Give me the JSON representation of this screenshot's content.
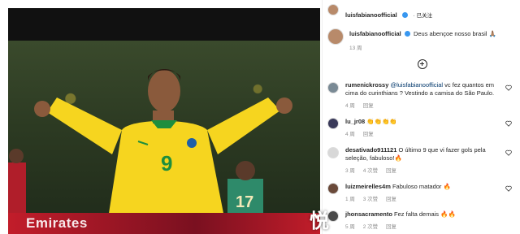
{
  "photo": {
    "banner_text": "Emirates"
  },
  "header": {
    "username": "luisfabianoofficial",
    "follow_label": "· 已关注"
  },
  "caption": {
    "username": "luisfabianoofficial",
    "text": "Deus abençoe nosso brasil 🙏🏽",
    "time": "13 周"
  },
  "comments": [
    {
      "username": "rumenickrossy",
      "mention": "@luisfabianoofficial",
      "text": " vc fez quantos em cima do curinthians ? Vestindo a camisa do São Paulo.",
      "time": "4 周",
      "reply_label": "回复",
      "likes": ""
    },
    {
      "username": "lu_jr08",
      "mention": "",
      "text": "👏👏👏👏",
      "time": "4 周",
      "reply_label": "回复",
      "likes": ""
    },
    {
      "username": "desativado911121",
      "mention": "",
      "text": "O último 9 que vi fazer gols pela seleção, fabuloso!🔥",
      "time": "3 周",
      "reply_label": "回复",
      "likes": "4 次赞"
    },
    {
      "username": "luizmeirelles4m",
      "mention": "",
      "text": "Fabuloso matador 🔥",
      "time": "1 周",
      "reply_label": "回复",
      "likes": "3 次赞"
    },
    {
      "username": "jhonsacramento",
      "mention": "",
      "text": "Fez falta demais 🔥🔥",
      "time": "5 周",
      "reply_label": "回复",
      "likes": "2 次赞"
    }
  ],
  "watermark": "悦",
  "colors": {
    "verified": "#3897f0",
    "mention": "#00376b",
    "meta": "#8e8e8e",
    "banner": "#c21d2a"
  },
  "icons": {
    "heart": "heart-icon",
    "add": "plus-circle-icon",
    "verified": "verified-badge-icon"
  }
}
